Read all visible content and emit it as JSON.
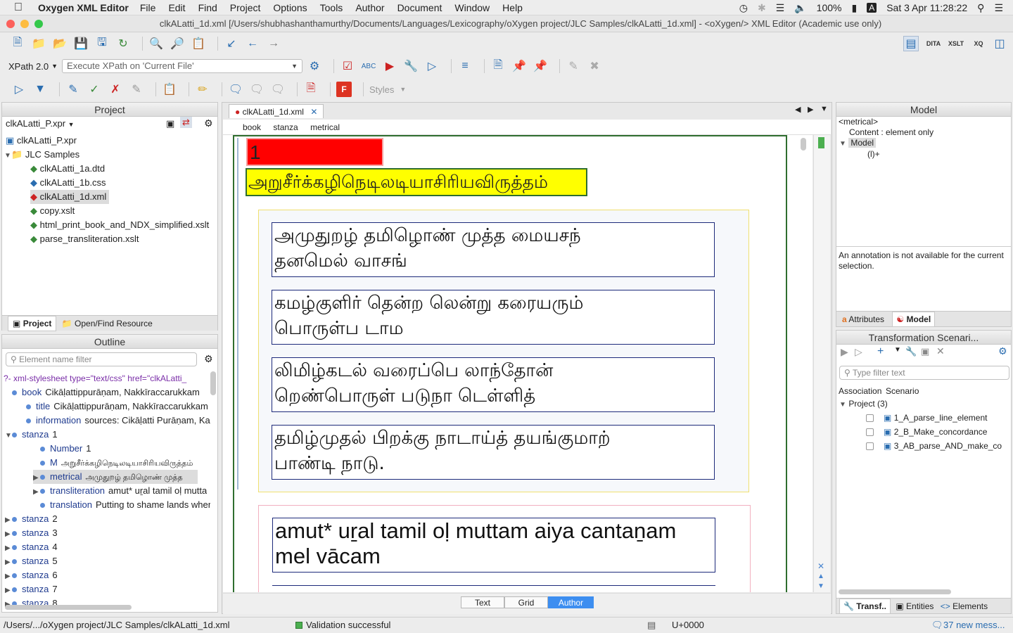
{
  "menubar": {
    "app": "Oxygen XML Editor",
    "items": [
      "File",
      "Edit",
      "Find",
      "Project",
      "Options",
      "Tools",
      "Author",
      "Document",
      "Window",
      "Help"
    ],
    "battery": "100%",
    "input": "A",
    "clock": "Sat 3 Apr  11:28:22"
  },
  "title": "clkALatti_1d.xml [/Users/shubhashanthamurthy/Documents/Languages/Lexicography/oXygen project/JLC Samples/clkALatti_1d.xml] - <oXygen/> XML Editor (Academic use only)",
  "xpath": {
    "version": "XPath 2.0",
    "placeholder": "Execute XPath on  'Current File'"
  },
  "styles_label": "Styles",
  "project": {
    "title": "Project",
    "file": "clkALatti_P.xpr",
    "root": "clkALatti_P.xpr",
    "folder": "JLC Samples",
    "files": [
      "clkALatti_1a.dtd",
      "clkALatti_1b.css",
      "clkALatti_1d.xml",
      "copy.xslt",
      "html_print_book_and_NDX_simplified.xslt",
      "parse_transliteration.xslt"
    ],
    "tab_project": "Project",
    "tab_open": "Open/Find Resource"
  },
  "outline": {
    "title": "Outline",
    "filter_placeholder": "Element name filter",
    "pi": "xml-stylesheet type=\"text/css\" href=\"clkALatti_",
    "rows": [
      {
        "tag": "book",
        "text": "Cikāḷattippurāṇam, Nakkīraccarukkam"
      },
      {
        "tag": "title",
        "text": "Cikāḷattippurāṇam, Nakkīraccarukkam"
      },
      {
        "tag": "information",
        "text": "sources: Cikāḷatti Purāṇam, Kai"
      },
      {
        "tag": "stanza",
        "text": "1"
      },
      {
        "tag": "Number",
        "text": "1"
      },
      {
        "tag": "M",
        "text": "அறுசீர்க்கழிநெடிலடியாசிரியவிருத்தம்"
      },
      {
        "tag": "metrical",
        "text": "அமுதுறழ் தமிழொண் முத்த"
      },
      {
        "tag": "transliteration",
        "text": "amut* uṟal tamil oḷ mutta"
      },
      {
        "tag": "translation",
        "text": "Putting to shame lands wher"
      },
      {
        "tag": "stanza",
        "text": "2"
      },
      {
        "tag": "stanza",
        "text": "3"
      },
      {
        "tag": "stanza",
        "text": "4"
      },
      {
        "tag": "stanza",
        "text": "5"
      },
      {
        "tag": "stanza",
        "text": "6"
      },
      {
        "tag": "stanza",
        "text": "7"
      },
      {
        "tag": "stanza",
        "text": "8"
      }
    ]
  },
  "editor": {
    "tab": "clkALatti_1d.xml",
    "breadcrumb": [
      "book",
      "stanza",
      "metrical"
    ],
    "number": "1",
    "meter": "அறுசீர்க்கழிநெடிலடியாசிரியவிருத்தம்",
    "lines": [
      [
        "அமுதுறழ் தமிழொண் முத்த மையசந்",
        "தனமெல் வாசங்"
      ],
      [
        "கமழ்குளிர் தென்ற லென்று கரையரும்",
        "பொருள்ப டாம"
      ],
      [
        "லிமிழ்கடல் வரைப்பெ லாந்தோன்",
        "றெண்பொருள் படுநா டெள்ளித்"
      ],
      [
        "தமிழ்முதல் பிறக்கு நாடாய்த் தயங்குமாற்",
        "பாண்டி நாடு."
      ]
    ],
    "translit": [
      "amut* uṟal tamil oḷ muttam aiya cantaṉam",
      "mel vācam"
    ],
    "mode_tabs": [
      "Text",
      "Grid",
      "Author"
    ]
  },
  "model": {
    "title": "Model",
    "element": "<metrical>",
    "content": "Content : element only",
    "model_label": "Model",
    "model_expr": "(l)+",
    "annotation": "An annotation is not available for the current selection.",
    "tab_attr": "Attributes",
    "tab_model": "Model"
  },
  "scenarios": {
    "title": "Transformation Scenari...",
    "filter_placeholder": "Type filter text",
    "col_assoc": "Association",
    "col_scen": "Scenario",
    "group": "Project (3)",
    "items": [
      "1_A_parse_line_element",
      "2_B_Make_concordance",
      "3_AB_parse_AND_make_co"
    ],
    "tabs": [
      "Transf..",
      "Entities",
      "Elements"
    ]
  },
  "status": {
    "path": "/Users/.../oXygen project/JLC Samples/clkALatti_1d.xml",
    "validation": "Validation successful",
    "unicode": "U+0000",
    "messages": "37 new mess..."
  }
}
